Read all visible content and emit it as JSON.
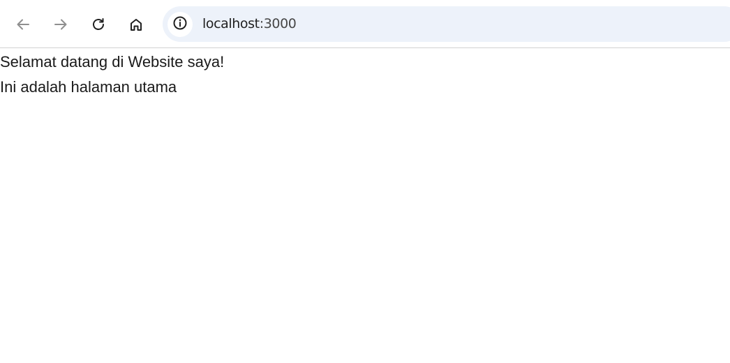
{
  "browser": {
    "back_icon": "arrow-left-icon",
    "forward_icon": "arrow-right-icon",
    "reload_icon": "reload-icon",
    "home_icon": "home-icon",
    "site_info_icon": "info-circle-icon",
    "address": {
      "host": "localhost",
      "port": ":3000"
    },
    "colors": {
      "omnibox_bg": "#edf2fa",
      "icon_active": "#1f1f1f",
      "icon_disabled": "#8f8f8f"
    }
  },
  "page": {
    "heading": "Selamat datang di Website saya!",
    "subtext": "Ini adalah halaman utama"
  }
}
